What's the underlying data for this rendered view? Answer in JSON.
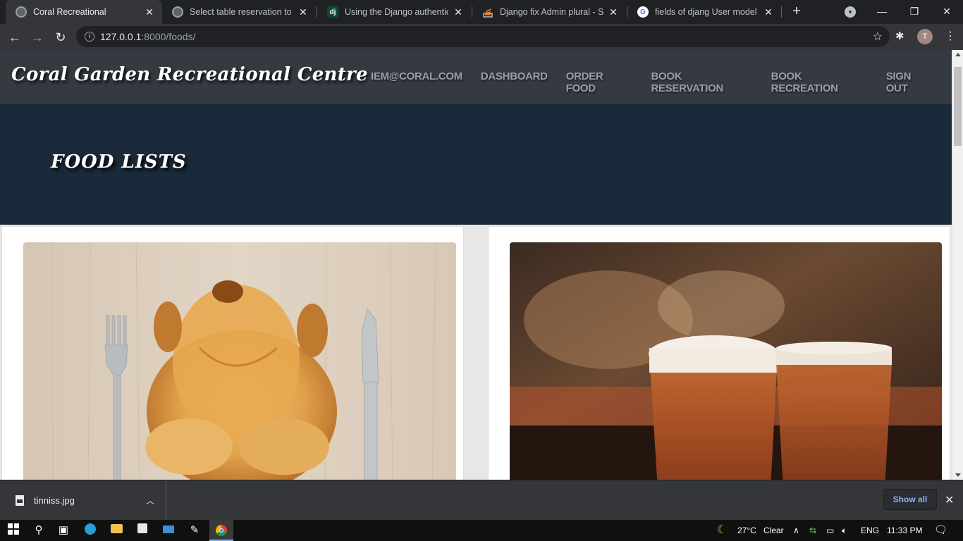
{
  "browser": {
    "tabs": [
      {
        "title": "Coral Recreational",
        "active": true,
        "icon": "globe-icon"
      },
      {
        "title": "Select table reservation to ch",
        "active": false,
        "icon": "globe-icon"
      },
      {
        "title": "Using the Django authenticat",
        "active": false,
        "icon": "django-icon",
        "icon_text": "dj"
      },
      {
        "title": "Django fix Admin plural - Sta",
        "active": false,
        "icon": "stackoverflow-icon"
      },
      {
        "title": "fields of djang User model - (",
        "active": false,
        "icon": "google-icon",
        "icon_text": "G"
      }
    ],
    "address": {
      "host": "127.0.0.1",
      "path": ":8000/foods/"
    },
    "avatar_initial": "T"
  },
  "site": {
    "brand": "Coral Garden Recreational Centre",
    "nav": [
      "IEM@CORAL.COM",
      "DASHBOARD",
      "ORDER FOOD",
      "BOOK RESERVATION",
      "BOOK RECREATION",
      "SIGN OUT"
    ],
    "hero_title": "FOOD LISTS",
    "cards": [
      {
        "image": "roast-chicken-image"
      },
      {
        "image": "beer-glasses-image"
      }
    ]
  },
  "download_bar": {
    "file_name": "tinniss.jpg",
    "show_all": "Show all"
  },
  "taskbar": {
    "weather_temp": "27°C",
    "weather_desc": "Clear",
    "language": "ENG",
    "time": "11:33 PM"
  },
  "colors": {
    "site_nav_bg": "#343a40",
    "hero_bg": "#1a2a3a",
    "nav_link": "#9a9fa5",
    "chrome_dark": "#202124",
    "chrome_toolbar": "#35363a"
  }
}
